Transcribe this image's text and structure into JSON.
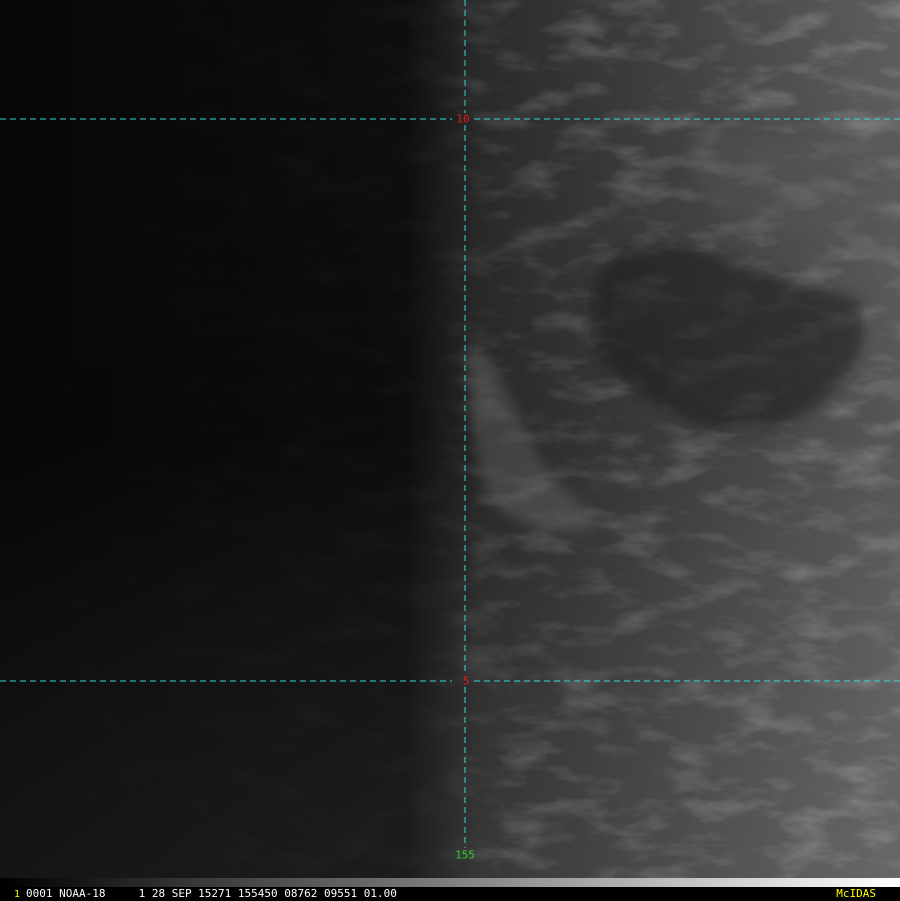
{
  "colors": {
    "grid_line": "#35d7d4",
    "lat_label": "#e01b1b",
    "lon_label": "#2ad32a",
    "frame_number": "#ffff00",
    "brand": "#ffff00",
    "status_text": "#ffffff"
  },
  "map": {
    "latitudes": [
      {
        "label": "10"
      },
      {
        "label": "5"
      }
    ],
    "longitudes": [
      {
        "label": "155"
      }
    ]
  },
  "status_bar": {
    "frame_number": "1",
    "text": "0001 NOAA-18     1 28 SEP 15271 155450 08762 09551 01.00",
    "brand": "McIDAS"
  }
}
